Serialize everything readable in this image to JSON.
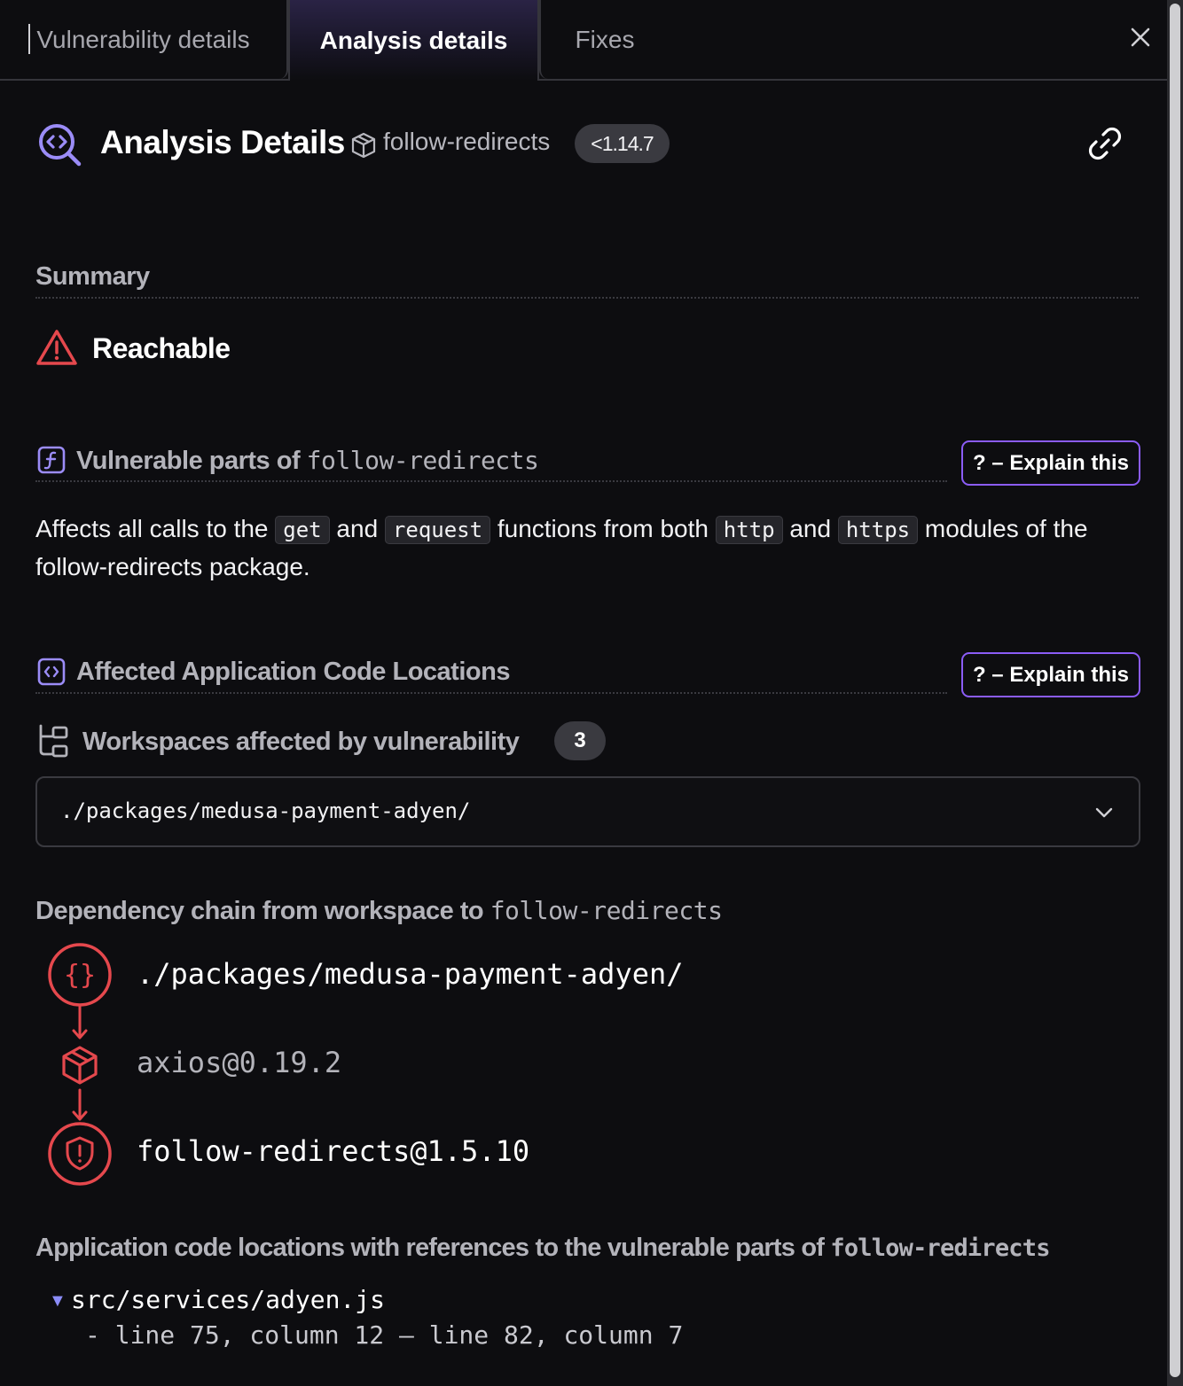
{
  "tabs": {
    "vulnerability": "Vulnerability details",
    "analysis": "Analysis details",
    "fixes": "Fixes"
  },
  "header": {
    "title": "Analysis Details",
    "package": "follow-redirects",
    "version_badge": "<1.14.7"
  },
  "summary": {
    "label": "Summary",
    "status": "Reachable"
  },
  "vulnerable_parts": {
    "label_prefix": "Vulnerable parts of ",
    "package": "follow-redirects",
    "explain_label": "? – Explain this",
    "text1": "Affects all calls to the ",
    "code1": "get",
    "text2": " and ",
    "code2": "request",
    "text3": " functions from both ",
    "code3": "http",
    "text4": " and ",
    "code4": "https",
    "text5": " modules of the follow-redirects package."
  },
  "affected": {
    "label": "Affected Application Code Locations",
    "explain_label": "? – Explain this",
    "workspaces_label": "Workspaces affected by vulnerability",
    "workspaces_count": "3",
    "selected_workspace": "./packages/medusa-payment-adyen/"
  },
  "dependency_chain": {
    "label_prefix": "Dependency chain from workspace to ",
    "package": "follow-redirects",
    "nodes": [
      "./packages/medusa-payment-adyen/",
      "axios@0.19.2",
      "follow-redirects@1.5.10"
    ]
  },
  "code_locations": {
    "label_prefix": "Application code locations with references to the vulnerable parts of ",
    "package": "follow-redirects",
    "file": "src/services/adyen.js",
    "range": "- line 75, column 12 – line 82, column 7"
  },
  "colors": {
    "accent": "#8b5cf6",
    "danger": "#e5484d",
    "background": "#0d0d10"
  }
}
